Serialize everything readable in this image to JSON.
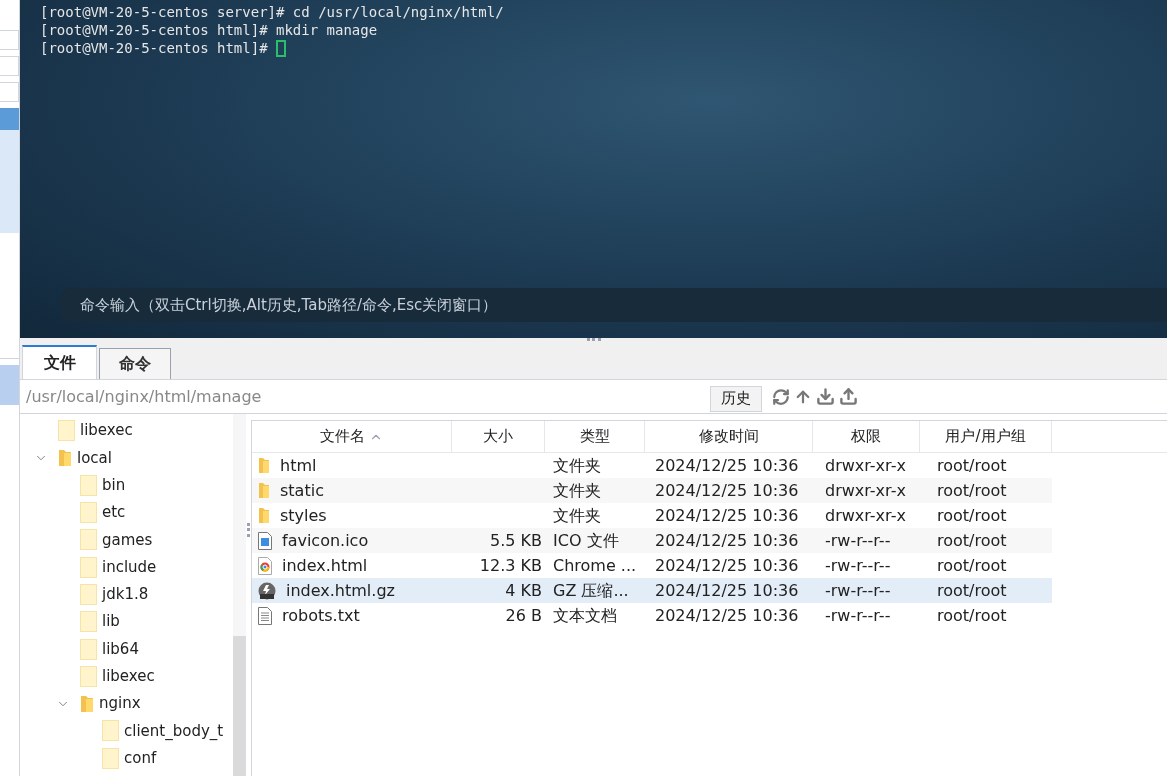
{
  "terminal": {
    "lines": [
      "[root@VM-20-5-centos server]# cd /usr/local/nginx/html/",
      "[root@VM-20-5-centos html]# mkdir manage",
      "[root@VM-20-5-centos html]# "
    ],
    "cursor": true,
    "command_hint": "命令输入（双击Ctrl切换,Alt历史,Tab路径/命令,Esc关闭窗口）"
  },
  "tabs": [
    {
      "label": "文件",
      "selected": true
    },
    {
      "label": "命令",
      "selected": false
    }
  ],
  "path": "/usr/local/nginx/html/manage",
  "history_button": "历史",
  "tree": [
    {
      "label": "libexec",
      "expanded": false
    },
    {
      "label": "local",
      "expanded": true,
      "children": [
        {
          "label": "bin",
          "expanded": false
        },
        {
          "label": "etc",
          "expanded": false
        },
        {
          "label": "games",
          "expanded": false
        },
        {
          "label": "include",
          "expanded": false
        },
        {
          "label": "jdk1.8",
          "expanded": false
        },
        {
          "label": "lib",
          "expanded": false
        },
        {
          "label": "lib64",
          "expanded": false
        },
        {
          "label": "libexec",
          "expanded": false
        },
        {
          "label": "nginx",
          "expanded": true,
          "children": [
            {
              "label": "client_body_t",
              "expanded": false
            },
            {
              "label": "conf",
              "expanded": false
            }
          ]
        }
      ]
    }
  ],
  "table": {
    "columns": [
      {
        "label": "文件名",
        "sorted": true
      },
      {
        "label": "大小",
        "sorted": false
      },
      {
        "label": "类型",
        "sorted": false
      },
      {
        "label": "修改时间",
        "sorted": false
      },
      {
        "label": "权限",
        "sorted": false
      },
      {
        "label": "用户/用户组",
        "sorted": false
      }
    ],
    "rows": [
      {
        "kind": "folder",
        "name": "html",
        "type": "文件夹",
        "modified": "2024/12/25 10:36",
        "perms": "drwxr-xr-x",
        "owner": "root/root",
        "selected": false
      },
      {
        "kind": "folder",
        "name": "static",
        "type": "文件夹",
        "modified": "2024/12/25 10:36",
        "perms": "drwxr-xr-x",
        "owner": "root/root",
        "selected": false
      },
      {
        "kind": "folder",
        "name": "styles",
        "type": "文件夹",
        "modified": "2024/12/25 10:36",
        "perms": "drwxr-xr-x",
        "owner": "root/root",
        "selected": false
      },
      {
        "kind": "image",
        "name": "favicon.ico",
        "size": "5.5 KB",
        "type": "ICO 文件",
        "modified": "2024/12/25 10:36",
        "perms": "-rw-r--r--",
        "owner": "root/root",
        "selected": false
      },
      {
        "kind": "chrome",
        "name": "index.html",
        "size": "12.3 KB",
        "type": "Chrome ...",
        "modified": "2024/12/25 10:36",
        "perms": "-rw-r--r--",
        "owner": "root/root",
        "selected": false
      },
      {
        "kind": "archive",
        "name": "index.html.gz",
        "size": "4 KB",
        "type": "GZ 压缩...",
        "modified": "2024/12/25 10:36",
        "perms": "-rw-r--r--",
        "owner": "root/root",
        "selected": true
      },
      {
        "kind": "text",
        "name": "robots.txt",
        "size": "26 B",
        "type": "文本文档",
        "modified": "2024/12/25 10:36",
        "perms": "-rw-r--r--",
        "owner": "root/root",
        "selected": false
      }
    ]
  }
}
